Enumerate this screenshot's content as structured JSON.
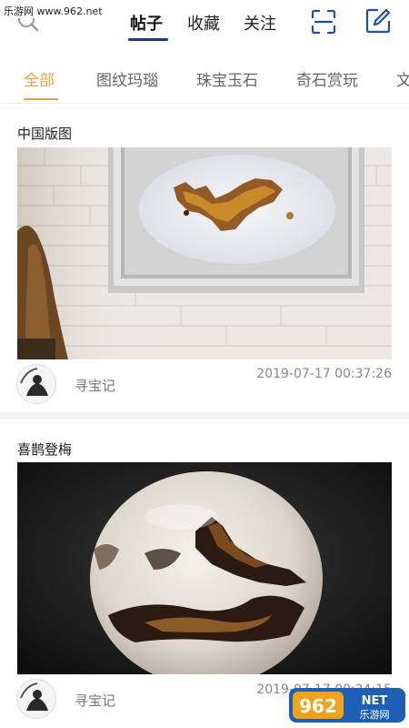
{
  "watermark_top": "乐游网 www.962.net",
  "header": {
    "tabs": [
      {
        "label": "帖子",
        "active": true
      },
      {
        "label": "收藏",
        "active": false
      },
      {
        "label": "关注",
        "active": false
      }
    ],
    "accent": "#1b3a8c"
  },
  "categories": {
    "accent": "#e8a33d",
    "items": [
      {
        "label": "全部",
        "active": true
      },
      {
        "label": "图纹玛瑙",
        "active": false
      },
      {
        "label": "珠宝玉石",
        "active": false
      },
      {
        "label": "奇石赏玩",
        "active": false
      },
      {
        "label": "文",
        "active": false
      }
    ]
  },
  "posts": [
    {
      "title": "中国版图",
      "author": "寻宝记",
      "time": "2019-07-17 00:37:26"
    },
    {
      "title": "喜鹊登梅",
      "author": "寻宝记",
      "time": "2019-07-17 00:24:15"
    }
  ],
  "logo_wm": {
    "text": "962",
    "suffix": "NET",
    "caption": "乐游网"
  }
}
